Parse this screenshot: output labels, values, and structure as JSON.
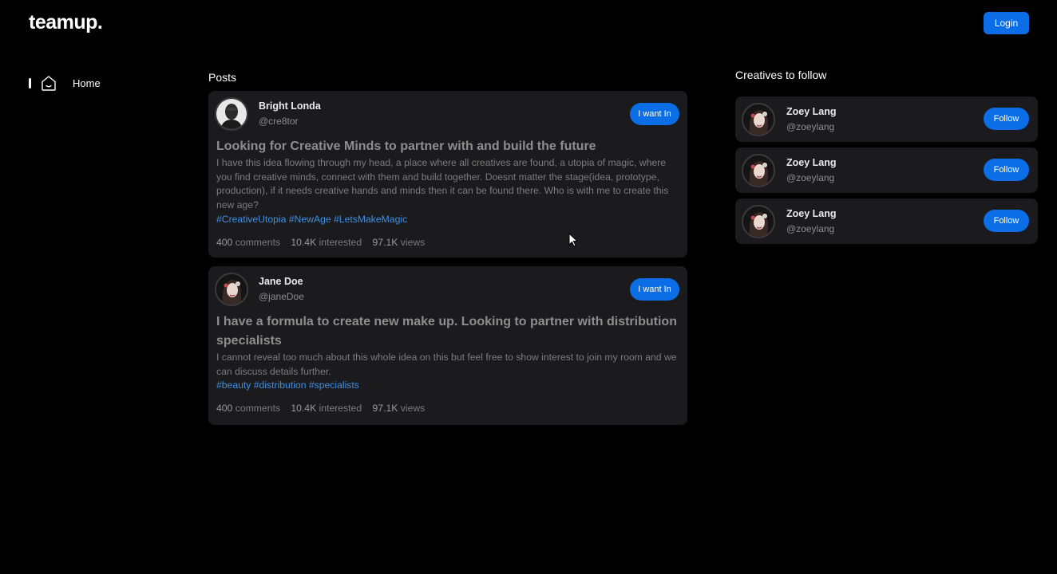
{
  "app": {
    "logo": "teamup.",
    "login_label": "Login"
  },
  "sidebar": {
    "items": [
      {
        "label": "Home",
        "icon": "home-icon",
        "active": true
      }
    ]
  },
  "posts": {
    "title": "Posts",
    "items": [
      {
        "author": "Bright Londa",
        "handle": "@cre8tor",
        "action_label": "I want In",
        "title": "Looking for Creative Minds to partner with and build the future",
        "body": "I have this idea flowing through my head, a place where all creatives are found, a utopia of magic, where you find creative minds, connect with them and build together. Doesnt matter the stage(idea, prototype, production), if it needs creative hands and minds then it can be found there. Who is with me to create this new age?",
        "tags": [
          "#CreativeUtopia",
          "#NewAge",
          "#LetsMakeMagic"
        ],
        "comments": "400",
        "comments_label": "comments",
        "interested": "10.4K",
        "interested_label": "interested",
        "views": "97.1K",
        "views_label": "views"
      },
      {
        "author": "Jane Doe",
        "handle": "@janeDoe",
        "action_label": "I want In",
        "title": "I have a formula to create new make up. Looking to partner with distribution specialists",
        "body": "I cannot reveal too much about this whole idea on this but feel free to show interest to join my room and we can discuss details further.",
        "tags": [
          "#beauty",
          "#distribution",
          "#specialists"
        ],
        "comments": "400",
        "comments_label": "comments",
        "interested": "10.4K",
        "interested_label": "interested",
        "views": "97.1K",
        "views_label": "views"
      }
    ]
  },
  "creatives": {
    "title": "Creatives to follow",
    "items": [
      {
        "name": "Zoey Lang",
        "handle": "@zoeylang",
        "action_label": "Follow"
      },
      {
        "name": "Zoey Lang",
        "handle": "@zoeylang",
        "action_label": "Follow"
      },
      {
        "name": "Zoey Lang",
        "handle": "@zoeylang",
        "action_label": "Follow"
      }
    ]
  },
  "colors": {
    "background": "#000000",
    "card": "#1b1b1d",
    "accent": "#0b6ee6",
    "tag": "#3d8fe8"
  }
}
